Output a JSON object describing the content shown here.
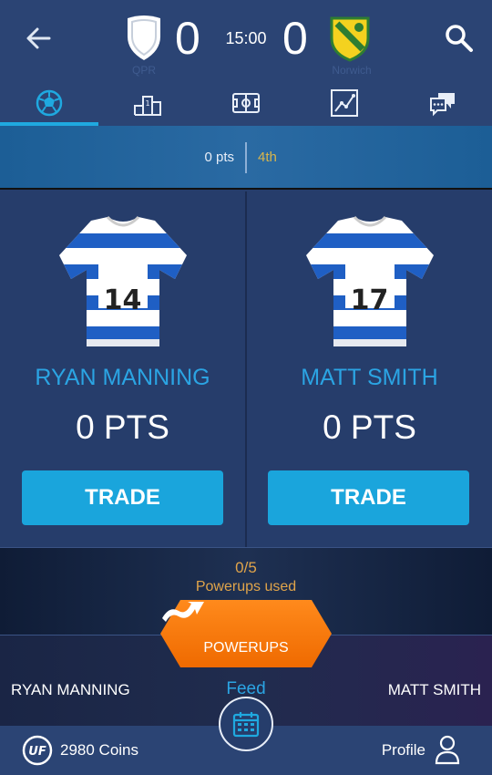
{
  "header": {
    "home_team": "QPR",
    "away_team": "Norwich",
    "home_score": "0",
    "away_score": "0",
    "clock": "15:00"
  },
  "tabs": [
    {
      "icon": "ball-icon",
      "active": true
    },
    {
      "icon": "podium-icon",
      "active": false
    },
    {
      "icon": "pitch-icon",
      "active": false
    },
    {
      "icon": "stats-chart-icon",
      "active": false
    },
    {
      "icon": "chat-icon",
      "active": false
    }
  ],
  "summary": {
    "points": "0 pts",
    "rank": "4th"
  },
  "players": [
    {
      "name": "RYAN MANNING",
      "number": "14",
      "points": "0 PTS",
      "trade_label": "TRADE"
    },
    {
      "name": "MATT SMITH",
      "number": "17",
      "points": "0 PTS",
      "trade_label": "TRADE"
    }
  ],
  "powerups": {
    "count": "0/5",
    "used_label": "Powerups used",
    "button_label": "POWERUPS"
  },
  "feed": {
    "left_player": "RYAN MANNING",
    "label": "Feed",
    "right_player": "MATT SMITH"
  },
  "bottom": {
    "coins_logo": "UF",
    "coins": "2980 Coins",
    "profile": "Profile"
  },
  "colors": {
    "accent": "#1aa5dc",
    "gold": "#e0a44a",
    "powerup": "#f57c00",
    "background": "#263d6b"
  }
}
